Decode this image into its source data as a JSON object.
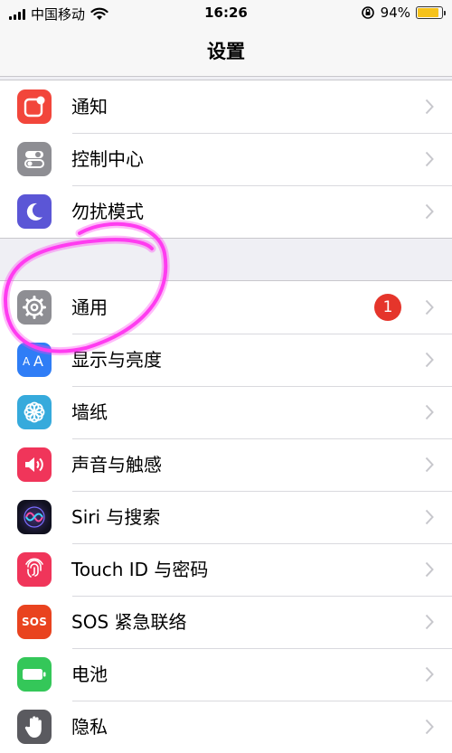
{
  "status_bar": {
    "carrier": "中国移动",
    "time": "16:26",
    "battery_percent": "94%",
    "battery_level": 0.94
  },
  "nav": {
    "title": "设置"
  },
  "group1": [
    {
      "label": "通知",
      "icon": "notifications-icon",
      "color": "#f2463b"
    },
    {
      "label": "控制中心",
      "icon": "control-center-icon",
      "color": "#8e8e93"
    },
    {
      "label": "勿扰模式",
      "icon": "moon-icon",
      "color": "#5b56d6"
    }
  ],
  "group2": [
    {
      "label": "通用",
      "icon": "gear-icon",
      "color": "#8e8e93",
      "badge": "1"
    },
    {
      "label": "显示与亮度",
      "icon": "display-icon",
      "color": "#2f7df6"
    },
    {
      "label": "墙纸",
      "icon": "wallpaper-icon",
      "color": "#36aadc"
    },
    {
      "label": "声音与触感",
      "icon": "speaker-icon",
      "color": "#f0355a"
    },
    {
      "label": "Siri 与搜索",
      "icon": "siri-icon",
      "color": "#1c1c2e"
    },
    {
      "label": "Touch ID 与密码",
      "icon": "fingerprint-icon",
      "color": "#f0355a"
    },
    {
      "label": "SOS 紧急联络",
      "icon": "sos-icon",
      "color": "#e9431f",
      "icon_text": "SOS"
    },
    {
      "label": "电池",
      "icon": "battery-icon",
      "color": "#34c759"
    },
    {
      "label": "隐私",
      "icon": "hand-icon",
      "color": "#5a5a5f"
    }
  ],
  "annotation_color": "#ff3cf0"
}
